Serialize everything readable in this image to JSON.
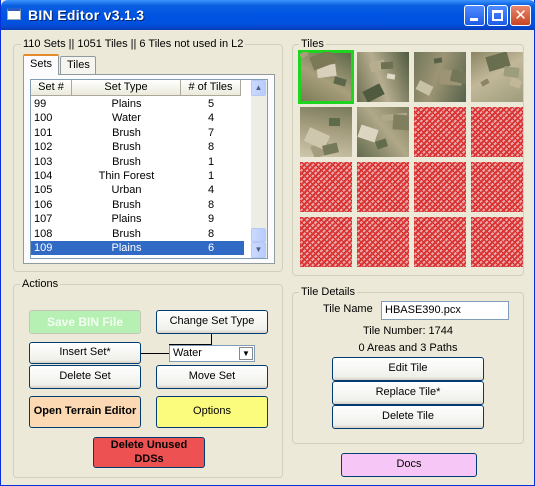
{
  "window": {
    "title": "BIN Editor v3.1.3",
    "close_glyph": "✕"
  },
  "sets_group": {
    "legend": "110 Sets || 1051 Tiles || 6 Tiles not used in L2",
    "tabs": [
      "Sets",
      "Tiles"
    ],
    "active_tab": "Sets",
    "columns": [
      "Set #",
      "Set Type",
      "# of Tiles"
    ],
    "rows": [
      {
        "num": "99",
        "type": "Plains",
        "tiles": "5"
      },
      {
        "num": "100",
        "type": "Water",
        "tiles": "4"
      },
      {
        "num": "101",
        "type": "Brush",
        "tiles": "7"
      },
      {
        "num": "102",
        "type": "Brush",
        "tiles": "8"
      },
      {
        "num": "103",
        "type": "Brush",
        "tiles": "1"
      },
      {
        "num": "104",
        "type": "Thin Forest",
        "tiles": "1"
      },
      {
        "num": "105",
        "type": "Urban",
        "tiles": "4"
      },
      {
        "num": "106",
        "type": "Brush",
        "tiles": "8"
      },
      {
        "num": "107",
        "type": "Plains",
        "tiles": "9"
      },
      {
        "num": "108",
        "type": "Brush",
        "tiles": "8"
      },
      {
        "num": "109",
        "type": "Plains",
        "tiles": "6"
      }
    ],
    "selected_row": "109",
    "scroll_up_icon": "▲",
    "scroll_down_icon": "▼"
  },
  "tiles_group": {
    "legend": "Tiles",
    "grid": [
      [
        "terrain-selected",
        "terrain",
        "terrain",
        "terrain"
      ],
      [
        "terrain",
        "terrain",
        "blank",
        "blank"
      ],
      [
        "blank",
        "blank",
        "blank",
        "blank"
      ],
      [
        "blank",
        "blank",
        "blank",
        "blank"
      ]
    ],
    "blank_pattern_color": "#dd3333",
    "selection_color": "#1fd41f"
  },
  "actions_group": {
    "legend": "Actions",
    "save_bin_file": "Save BIN File",
    "change_set_type": "Change Set Type",
    "insert_set": "Insert Set*",
    "set_type_value": "Water",
    "dropdown_icon": "▼",
    "delete_set": "Delete Set",
    "move_set": "Move Set",
    "open_terrain_editor": "Open Terrain Editor",
    "options": "Options",
    "delete_unused_dds": "Delete Unused DDSs"
  },
  "tile_details": {
    "legend": "Tile Details",
    "tile_name_label": "Tile Name",
    "tile_name_value": "HBASE390.pcx",
    "tile_number": "Tile Number: 1744",
    "areas_paths": "0 Areas and 3 Paths",
    "edit_tile": "Edit Tile",
    "replace_tile": "Replace Tile*",
    "delete_tile": "Delete Tile"
  },
  "footer": {
    "docs": "Docs"
  },
  "colors": {
    "window_bg": "#ece9d8",
    "title_blue": "#0054e3",
    "selection_blue": "#316ac5",
    "save_disabled_green": "#b7f0b3",
    "peach": "#fcd9b3",
    "yellow": "#fbfb7d",
    "red": "#ee5151",
    "pink": "#f6c6f6"
  }
}
